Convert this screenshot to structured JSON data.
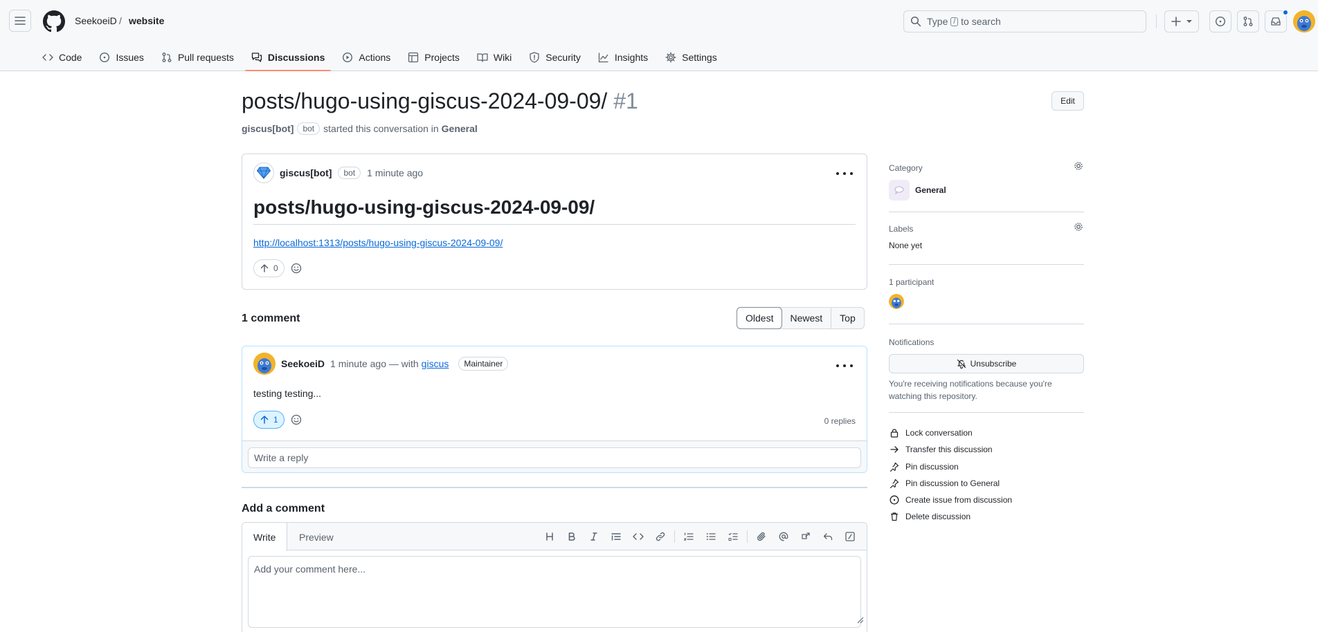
{
  "header": {
    "owner": "SeekoeiD",
    "separator": "/",
    "repo": "website",
    "search_prefix": "Type",
    "search_key": "/",
    "search_suffix": "to search"
  },
  "nav": [
    {
      "label": "Code",
      "icon": "code-icon"
    },
    {
      "label": "Issues",
      "icon": "issue-icon"
    },
    {
      "label": "Pull requests",
      "icon": "pull-request-icon"
    },
    {
      "label": "Discussions",
      "icon": "discussion-icon",
      "active": true
    },
    {
      "label": "Actions",
      "icon": "play-icon"
    },
    {
      "label": "Projects",
      "icon": "table-icon"
    },
    {
      "label": "Wiki",
      "icon": "book-icon"
    },
    {
      "label": "Security",
      "icon": "shield-icon"
    },
    {
      "label": "Insights",
      "icon": "graph-icon"
    },
    {
      "label": "Settings",
      "icon": "gear-icon"
    }
  ],
  "discussion": {
    "title": "posts/hugo-using-giscus-2024-09-09/",
    "number": "#1",
    "edit_label": "Edit",
    "starter": "giscus[bot]",
    "bot_badge": "bot",
    "started_text": "started this conversation in",
    "category": "General"
  },
  "post": {
    "author": "giscus[bot]",
    "badge": "bot",
    "time": "1 minute ago",
    "heading": "posts/hugo-using-giscus-2024-09-09/",
    "link": "http://localhost:1313/posts/hugo-using-giscus-2024-09-09/",
    "upvotes": "0"
  },
  "comments": {
    "count_label": "1 comment",
    "sort": [
      "Oldest",
      "Newest",
      "Top"
    ],
    "items": [
      {
        "author": "SeekoeiD",
        "time_with": "1 minute ago — with",
        "via": "giscus",
        "role": "Maintainer",
        "body": "testing testing...",
        "upvotes": "1",
        "replies": "0 replies",
        "reply_placeholder": "Write a reply"
      }
    ]
  },
  "add_comment": {
    "title": "Add a comment",
    "tab_write": "Write",
    "tab_preview": "Preview",
    "placeholder": "Add your comment here..."
  },
  "sidebar": {
    "category_title": "Category",
    "category_value": "General",
    "labels_title": "Labels",
    "labels_value": "None yet",
    "participants_title": "1 participant",
    "notifications_title": "Notifications",
    "unsubscribe_label": "Unsubscribe",
    "notification_note": "You're receiving notifications because you're watching this repository.",
    "actions": [
      {
        "label": "Lock conversation",
        "icon": "lock-icon"
      },
      {
        "label": "Transfer this discussion",
        "icon": "arrow-right-icon"
      },
      {
        "label": "Pin discussion",
        "icon": "pin-icon"
      },
      {
        "label": "Pin discussion to General",
        "icon": "pin-icon"
      },
      {
        "label": "Create issue from discussion",
        "icon": "issue-icon"
      },
      {
        "label": "Delete discussion",
        "icon": "trash-icon"
      }
    ]
  },
  "colors": {
    "accent": "#0969da",
    "nav_underline": "#fd8c73",
    "comment_border": "#b6e3ff"
  }
}
